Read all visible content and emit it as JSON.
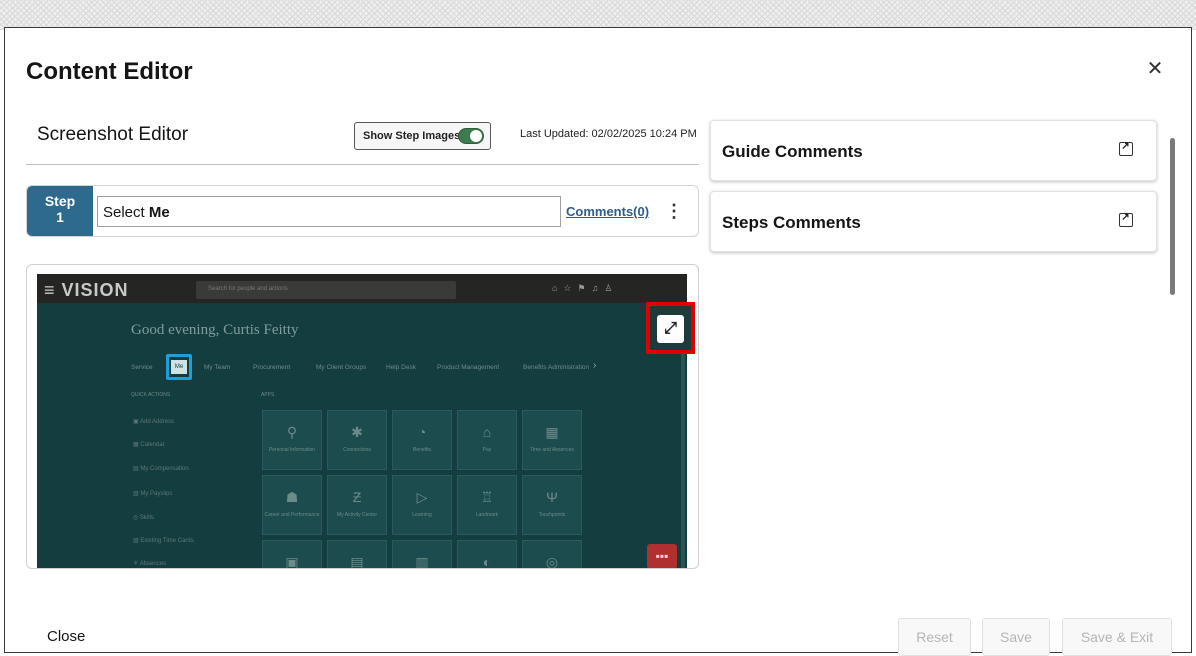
{
  "dialog": {
    "title": "Content Editor",
    "close_icon": "close-icon"
  },
  "left": {
    "title": "Screenshot Editor",
    "show_step_images_label": "Show Step Images",
    "show_step_images_on": true,
    "last_updated": "Last Updated: 02/02/2025 10:24 PM",
    "step": {
      "label": "Step",
      "number": "1",
      "text_prefix": "Select ",
      "text_bold": "Me",
      "comments_link": "Comments(0)",
      "more_icon": "more-vertical-icon"
    }
  },
  "screenshot": {
    "logo": "≡ VISION",
    "search_placeholder": "Search for people and actions",
    "greeting": "Good evening, Curtis Feitty",
    "tabs": [
      "Service",
      "Me",
      "My Team",
      "Procurement",
      "My Client Groups",
      "Help Desk",
      "Product Management",
      "Benefits Administration"
    ],
    "active_tab": "Me",
    "quick_actions_header": "QUICK ACTIONS",
    "apps_header": "APPS",
    "quick_actions": [
      "Add Address",
      "Calendar",
      "My Compensation",
      "My Payslips",
      "Skills",
      "Existing Time Cards",
      "Absences"
    ],
    "apps_row1": [
      "Personal Information",
      "Connections",
      "Benefits",
      "Pay",
      "Time and Absences"
    ],
    "apps_row2": [
      "Career and Performance",
      "My Activity Center",
      "Learning",
      "Landmark",
      "Touchpoints"
    ],
    "expand_icon": "expand-icon"
  },
  "right": {
    "cards": [
      {
        "title": "Guide Comments",
        "icon": "popout-icon"
      },
      {
        "title": "Steps Comments",
        "icon": "popout-icon"
      }
    ]
  },
  "footer": {
    "close_label": "Close",
    "reset_label": "Reset",
    "save_label": "Save",
    "save_exit_label": "Save & Exit"
  }
}
